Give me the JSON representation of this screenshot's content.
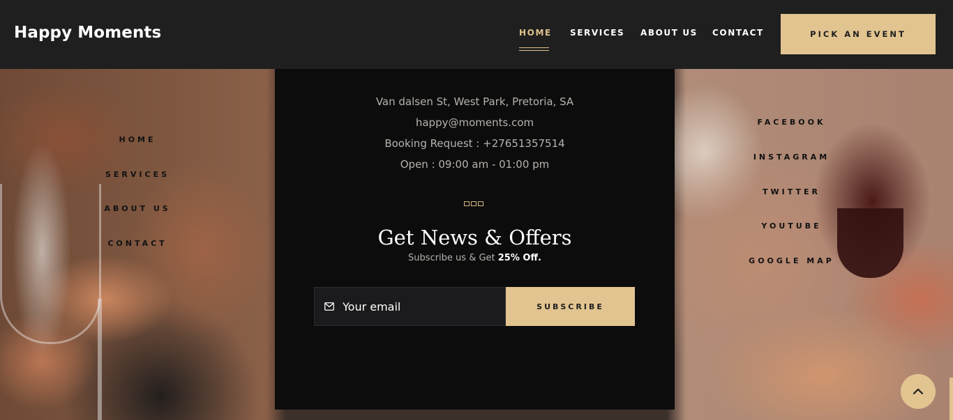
{
  "header": {
    "brand": "Happy Moments",
    "nav": [
      {
        "label": "HOME",
        "active": true
      },
      {
        "label": "SERVICES",
        "active": false
      },
      {
        "label": "ABOUT US",
        "active": false
      },
      {
        "label": "CONTACT",
        "active": false
      }
    ],
    "cta_label": "PICK AN EVENT"
  },
  "side_nav": [
    "HOME",
    "SERVICES",
    "ABOUT US",
    "CONTACT"
  ],
  "contact": {
    "address": "Van dalsen St, West Park, Pretoria, SA",
    "email": "happy@moments.com",
    "booking": "Booking Request : +27651357514",
    "hours": "Open : 09:00 am - 01:00 pm"
  },
  "newsletter": {
    "title": "Get News & Offers",
    "subtitle_prefix": "Subscribe us & Get ",
    "subtitle_highlight": "25% Off.",
    "email_placeholder": "Your email",
    "subscribe_label": "SUBSCRIBE"
  },
  "social": [
    "FACEBOOK",
    "INSTAGRAM",
    "TWITTER",
    "YOUTUBE",
    "GOOGLE MAP"
  ],
  "icons": {
    "mail": "mail-icon",
    "back_to_top": "chevron-up-icon"
  },
  "colors": {
    "accent": "#e2c490",
    "header_bg": "#1f1f1f",
    "panel_bg": "#0d0c0c"
  }
}
